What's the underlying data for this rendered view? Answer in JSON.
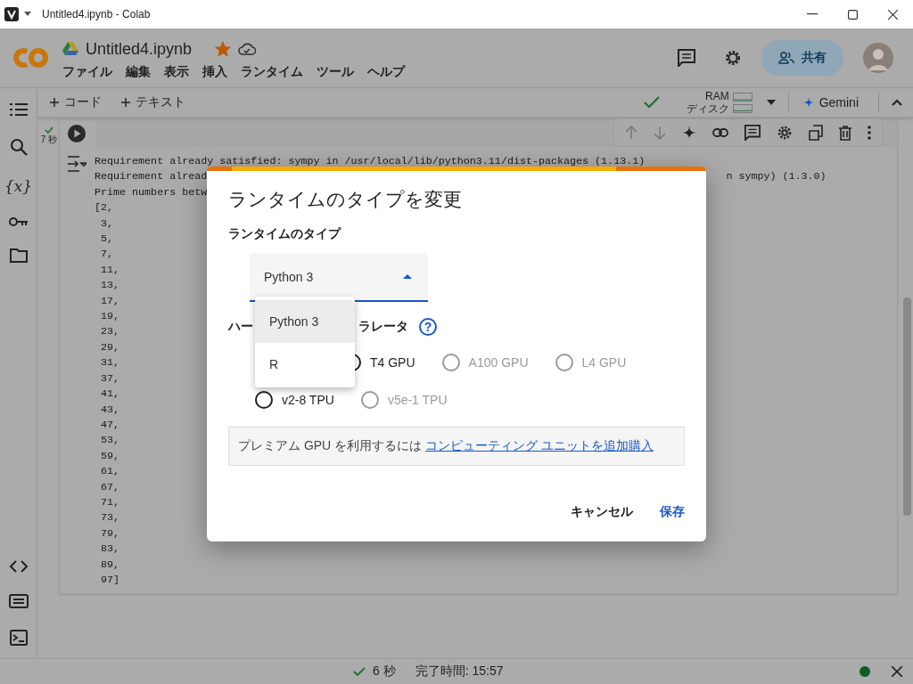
{
  "window": {
    "title": "Untitled4.ipynb - Colab"
  },
  "notebook": {
    "title": "Untitled4.ipynb",
    "starred": true
  },
  "menu": [
    "ファイル",
    "編集",
    "表示",
    "挿入",
    "ランタイム",
    "ツール",
    "ヘルプ"
  ],
  "share_button": "共有",
  "variables_icon": "{x}",
  "toolbar": {
    "add_code": "コード",
    "add_text": "テキスト",
    "ram_label": "RAM",
    "disk_label": "ディスク",
    "gemini": "Gemini"
  },
  "cell": {
    "exec_time": "7 秒",
    "output": [
      {
        "text": "Requirement already satisfied: sympy in /usr/local/lib/python3.11/dist-packages (1.13.1)"
      },
      {
        "text": "Requirement alread",
        "continued": "n sympy) (1.3.0)"
      },
      {
        "text": "Prime numbers betw"
      },
      {
        "text": "[2,"
      },
      {
        "text": " 3,"
      },
      {
        "text": " 5,"
      },
      {
        "text": " 7,"
      },
      {
        "text": " 11,"
      },
      {
        "text": " 13,"
      },
      {
        "text": " 17,"
      },
      {
        "text": " 19,"
      },
      {
        "text": " 23,"
      },
      {
        "text": " 29,"
      },
      {
        "text": " 31,"
      },
      {
        "text": " 37,"
      },
      {
        "text": " 41,"
      },
      {
        "text": " 43,"
      },
      {
        "text": " 47,"
      },
      {
        "text": " 53,"
      },
      {
        "text": " 59,"
      },
      {
        "text": " 61,"
      },
      {
        "text": " 67,"
      },
      {
        "text": " 71,"
      },
      {
        "text": " 73,"
      },
      {
        "text": " 79,"
      },
      {
        "text": " 83,"
      },
      {
        "text": " 89,"
      },
      {
        "text": " 97]"
      }
    ]
  },
  "dialog": {
    "title": "ランタイムのタイプを変更",
    "runtime_label": "ランタイムのタイプ",
    "runtime_value": "Python 3",
    "runtime_options": [
      {
        "label": "Python 3",
        "selected": true
      },
      {
        "label": "R",
        "selected": false
      }
    ],
    "hardware_label_start": "ハー",
    "hardware_label_end": "ラレータ",
    "help_icon": "?",
    "accelerator_rows": [
      [
        {
          "label": "T4 GPU",
          "selected": false,
          "disabled": false
        },
        {
          "label": "A100 GPU",
          "selected": false,
          "disabled": true
        },
        {
          "label": "L4 GPU",
          "selected": false,
          "disabled": true
        }
      ],
      [
        {
          "label": "v2-8 TPU",
          "selected": false,
          "disabled": false
        },
        {
          "label": "v5e-1 TPU",
          "selected": false,
          "disabled": true
        }
      ]
    ],
    "notice": "プレミアム GPU を利用するには",
    "notice_link": "コンピューティング ユニットを追加購入",
    "cancel": "キャンセル",
    "save": "保存"
  },
  "status_bar": {
    "duration": "6 秒",
    "completed": "完了時間: 15:57"
  }
}
